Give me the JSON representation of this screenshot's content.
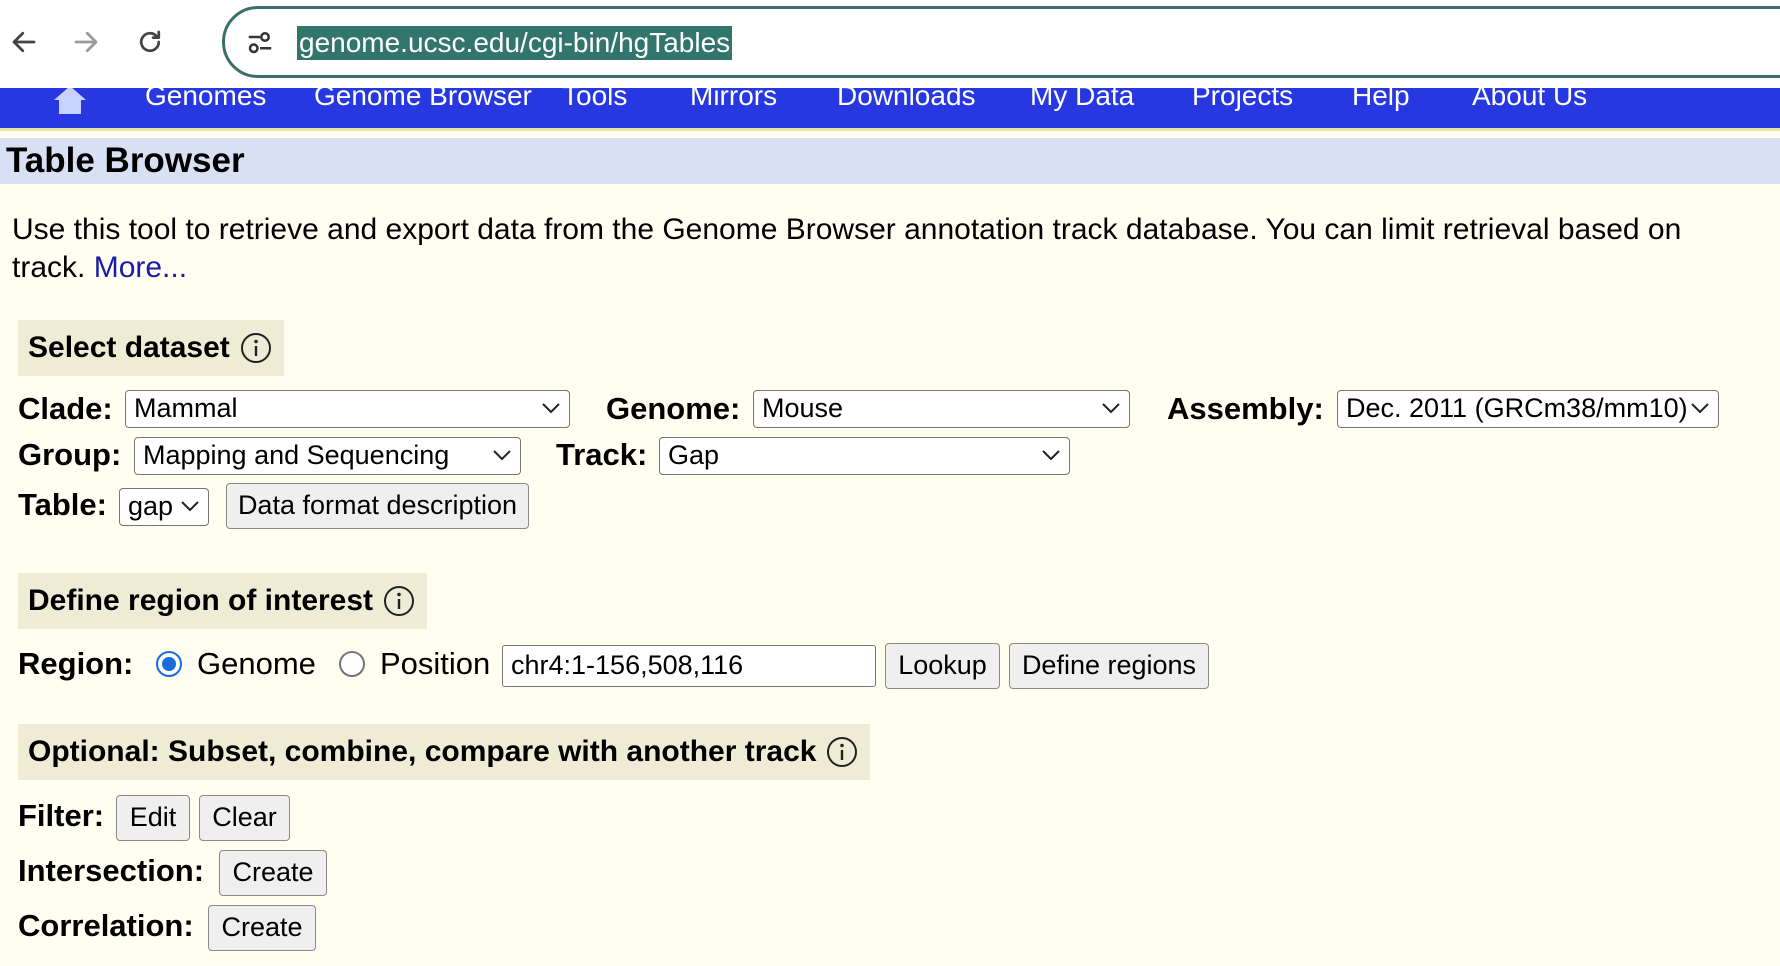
{
  "browser": {
    "url": "genome.ucsc.edu/cgi-bin/hgTables",
    "back_icon": "back-arrow-icon",
    "forward_icon": "forward-arrow-icon",
    "reload_icon": "reload-icon",
    "site_info_icon": "tune-icon"
  },
  "site_nav": {
    "home_icon": "home-icon",
    "items": [
      "Genomes",
      "Genome Browser",
      "Tools",
      "Mirrors",
      "Downloads",
      "My Data",
      "Projects",
      "Help",
      "About Us"
    ]
  },
  "page": {
    "title": "Table Browser",
    "intro_line1": "Use this tool to retrieve and export data from the Genome Browser annotation track database. You can limit retrieval based on",
    "intro_line2": "track.",
    "more_link": "More..."
  },
  "select_dataset": {
    "header": "Select dataset",
    "clade_label": "Clade:",
    "clade_value": "Mammal",
    "genome_label": "Genome:",
    "genome_value": "Mouse",
    "assembly_label": "Assembly:",
    "assembly_value": "Dec. 2011 (GRCm38/mm10)",
    "group_label": "Group:",
    "group_value": "Mapping and Sequencing",
    "track_label": "Track:",
    "track_value": "Gap",
    "table_label": "Table:",
    "table_value": "gap",
    "data_format_button": "Data format description"
  },
  "region": {
    "header": "Define region of interest",
    "region_label": "Region:",
    "genome_option": "Genome",
    "position_option": "Position",
    "selected": "Genome",
    "position_value": "chr4:1-156,508,116",
    "lookup_button": "Lookup",
    "define_regions_button": "Define regions"
  },
  "optional": {
    "header": "Optional: Subset, combine, compare with another track",
    "filter_label": "Filter:",
    "filter_edit": "Edit",
    "filter_clear": "Clear",
    "intersection_label": "Intersection:",
    "intersection_create": "Create",
    "correlation_label": "Correlation:",
    "correlation_create": "Create"
  },
  "colors": {
    "page_bg": "#fffef0",
    "nav_blue": "#2838e0",
    "title_bar": "#d8e0f4",
    "section_bg": "#efecd6",
    "link": "#1a1ca8",
    "radio_accent": "#1a6bdc"
  }
}
